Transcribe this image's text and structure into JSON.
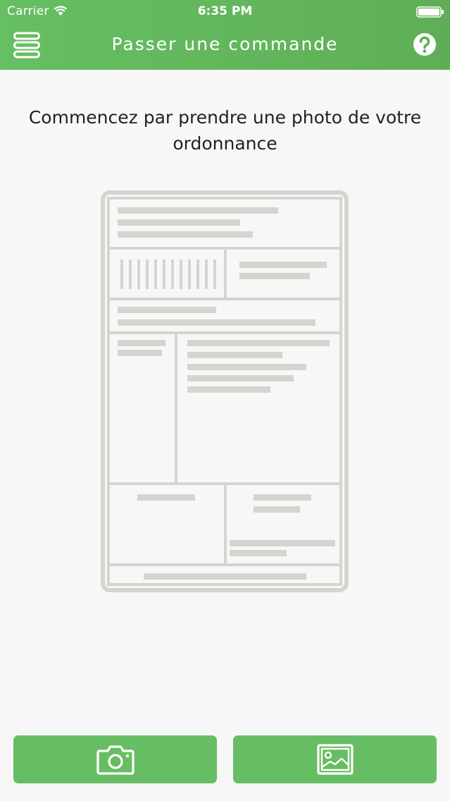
{
  "status_bar": {
    "carrier": "Carrier",
    "time": "6:35 PM"
  },
  "header": {
    "title": "Passer une commande",
    "menu_icon": "menu-icon",
    "help_icon": "help-icon"
  },
  "main": {
    "instruction": "Commencez par prendre une photo de votre ordonnance",
    "illustration_icon": "prescription-illustration"
  },
  "actions": {
    "camera_icon": "camera-icon",
    "gallery_icon": "image-icon"
  },
  "colors": {
    "header_green": "#66bf62",
    "button_green": "#67bd63",
    "background": "#f7f7f7",
    "illustration_gray": "#d6d4cf"
  }
}
